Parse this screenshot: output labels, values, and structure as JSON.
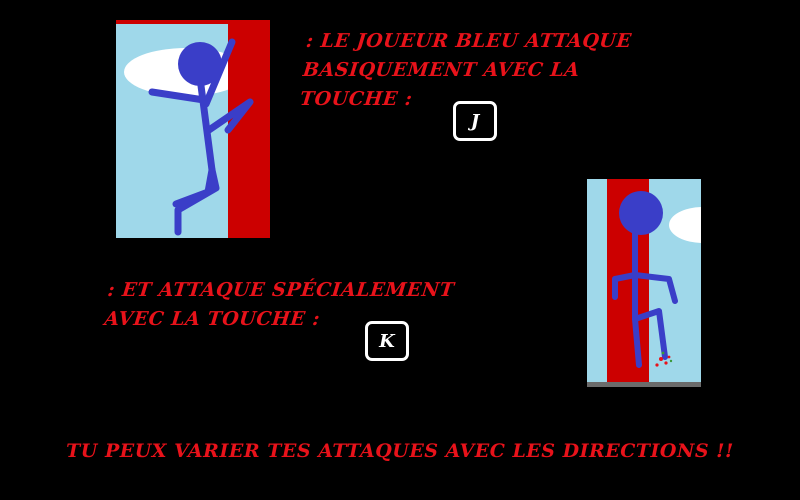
{
  "tutorial": {
    "basic_attack_text": ": LE JOUEUR BLEU ATTAQUE\nBASIQUEMENT AVEC LA\nTOUCHE :",
    "basic_attack_key": "J",
    "special_attack_text": ": ET ATTAQUE SPÉCIALEMENT\nAVEC LA TOUCHE :",
    "special_attack_key": "K",
    "footer_text": "TU PEUX VARIER TES ATTAQUES AVEC LES DIRECTIONS !!"
  },
  "colors": {
    "background": "#000000",
    "text_red": "#e8121a",
    "sky_blue": "#9fd8ea",
    "wall_red": "#cc0000",
    "player_blue": "#3a3ec8",
    "cloud_white": "#ffffff"
  },
  "icons": {
    "basic_attack_illustration": "blue-stickman-punch",
    "special_attack_illustration": "blue-stickman-kick"
  }
}
